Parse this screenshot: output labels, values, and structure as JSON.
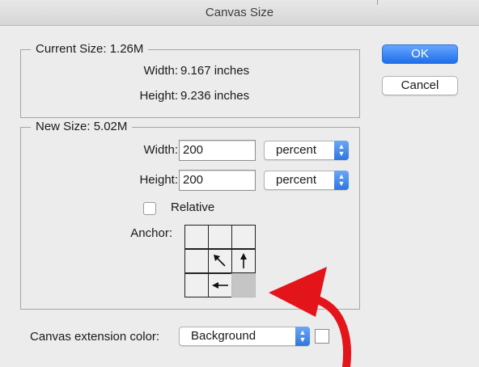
{
  "window": {
    "title": "Canvas Size"
  },
  "current_size": {
    "legend": "Current Size: 1.26M",
    "width_label": "Width:",
    "width_value": "9.167 inches",
    "height_label": "Height:",
    "height_value": "9.236 inches"
  },
  "new_size": {
    "legend": "New Size: 5.02M",
    "width_label": "Width:",
    "width_value": "200",
    "width_unit": "percent",
    "height_label": "Height:",
    "height_value": "200",
    "height_unit": "percent",
    "relative_label": "Relative",
    "relative_checked": false,
    "anchor_label": "Anchor:",
    "anchor_selected": "bottom-right"
  },
  "buttons": {
    "ok": "OK",
    "cancel": "Cancel"
  },
  "extension": {
    "label": "Canvas extension color:",
    "value": "Background",
    "swatch_color": "#ffffff"
  },
  "colors": {
    "accent": "#2f76e0",
    "annotation_arrow": "#e3151a"
  },
  "icons": {
    "anchor_arrows": [
      "arrow-up-left-icon",
      "arrow-up-icon",
      "arrow-left-icon"
    ],
    "annotation": "curved-red-arrow-icon"
  }
}
